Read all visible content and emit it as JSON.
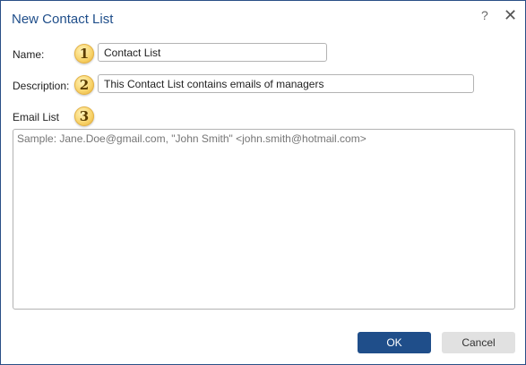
{
  "dialog": {
    "title": "New Contact List",
    "help_label": "?",
    "close_label": "✕"
  },
  "form": {
    "name_label": "Name:",
    "name_badge": "1",
    "name_value": "Contact List",
    "description_label": "Description:",
    "description_badge": "2",
    "description_value": "This Contact List contains emails of managers",
    "email_label": "Email List",
    "email_badge": "3",
    "email_placeholder": "Sample: Jane.Doe@gmail.com, \"John Smith\" <john.smith@hotmail.com>"
  },
  "buttons": {
    "ok_label": "OK",
    "cancel_label": "Cancel"
  },
  "colors": {
    "accent": "#1f4e8a",
    "badge": "#f8d36a"
  }
}
